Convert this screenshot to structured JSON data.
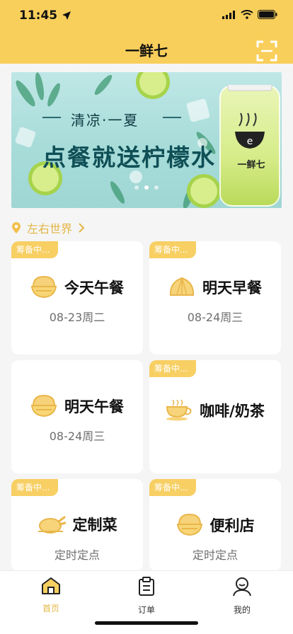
{
  "status": {
    "time": "11:45"
  },
  "header": {
    "title": "一鲜七"
  },
  "banner": {
    "subtitle": "清凉·一夏",
    "headline": "点餐就送柠檬水",
    "brand": "一鲜七"
  },
  "location": {
    "name": "左右世界"
  },
  "cards": [
    {
      "tag": "筹备中...",
      "name": "今天午餐",
      "sub": "08-23周二",
      "icon": "rice-bowl-icon"
    },
    {
      "tag": "筹备中...",
      "name": "明天早餐",
      "sub": "08-24周三",
      "icon": "bun-icon"
    },
    {
      "tag": "",
      "name": "明天午餐",
      "sub": "08-24周三",
      "icon": "rice-bowl-icon"
    },
    {
      "tag": "筹备中...",
      "name": "咖啡/奶茶",
      "sub": "",
      "icon": "coffee-cup-icon"
    },
    {
      "tag": "筹备中...",
      "name": "定制菜",
      "sub": "定时定点",
      "icon": "roast-chicken-icon"
    },
    {
      "tag": "筹备中...",
      "name": "便利店",
      "sub": "定时定点",
      "icon": "rice-bowl-icon"
    }
  ],
  "nav": [
    {
      "label": "首页",
      "icon": "home-icon",
      "active": true
    },
    {
      "label": "订单",
      "icon": "clipboard-icon",
      "active": false
    },
    {
      "label": "我的",
      "icon": "user-icon",
      "active": false
    }
  ],
  "colors": {
    "header": "#f9cf5b",
    "tag": "#f7cf63",
    "accent": "#e3b744",
    "icon": "#f5cf6a"
  }
}
